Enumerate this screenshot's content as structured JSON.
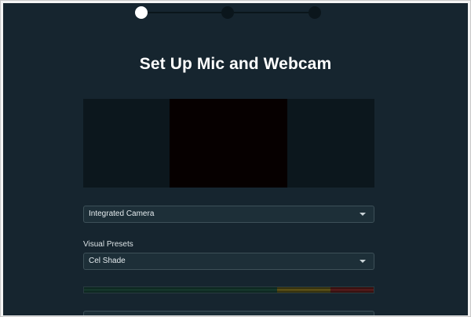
{
  "wizard": {
    "steps": [
      {
        "state": "active"
      },
      {
        "state": "inactive"
      },
      {
        "state": "inactive"
      }
    ]
  },
  "page": {
    "title": "Set Up Mic and Webcam"
  },
  "camera": {
    "selected": "Integrated Camera"
  },
  "visual_presets": {
    "label": "Visual Presets",
    "selected": "Cel Shade"
  },
  "mic_meter": {
    "level": 0,
    "zones": [
      "green",
      "yellow",
      "red"
    ]
  },
  "colors": {
    "background": "#16252f",
    "accent_active_step": "#ffffff",
    "field_background": "#1d2f38",
    "field_border": "#3d5058"
  }
}
